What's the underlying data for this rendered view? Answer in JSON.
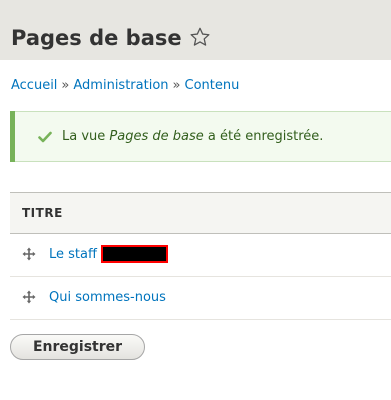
{
  "header": {
    "title": "Pages de base"
  },
  "breadcrumb": {
    "items": [
      "Accueil",
      "Administration",
      "Contenu"
    ],
    "separator": "»"
  },
  "message": {
    "prefix": "La vue ",
    "view_name": "Pages de base",
    "suffix": " a été enregistrée."
  },
  "table": {
    "header_title": "TITRE",
    "rows": [
      {
        "title": "Le staff",
        "redacted": true
      },
      {
        "title": "Qui sommes-nous",
        "redacted": false
      }
    ]
  },
  "form": {
    "save_label": "Enregistrer"
  },
  "colors": {
    "link": "#0074bd",
    "header_bg": "#e7e6e1",
    "success_bar": "#77b259",
    "success_bg": "#f3faef",
    "redaction_border": "#ff0000"
  }
}
